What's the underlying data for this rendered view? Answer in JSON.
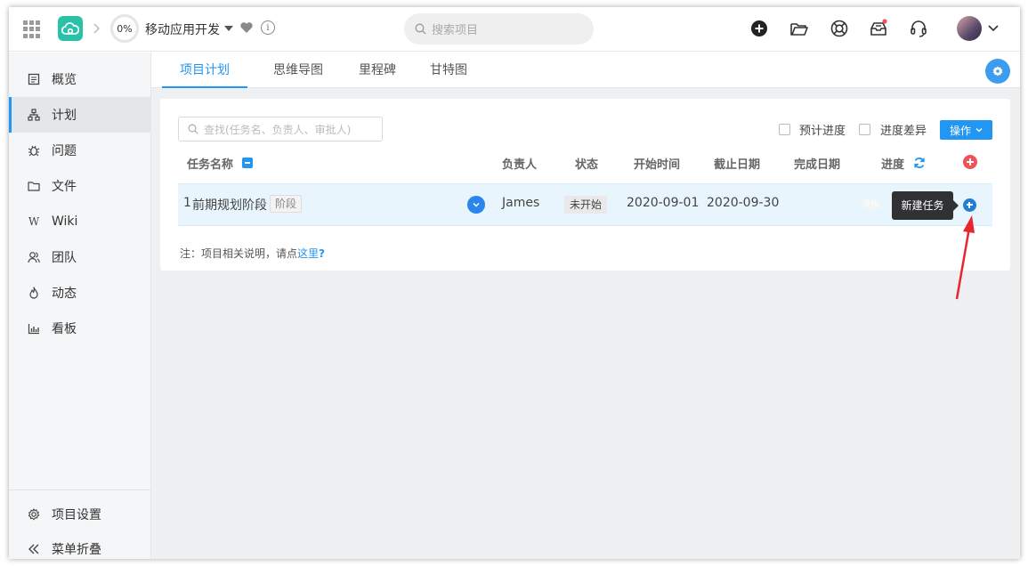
{
  "topbar": {
    "progress": "0%",
    "project_name": "移动应用开发",
    "search_placeholder": "搜索项目",
    "colors": {
      "logo": "#28c2a8",
      "notify_dot": "#f0525b"
    }
  },
  "sidebar": {
    "items": [
      {
        "label": "概览",
        "icon": "overview-icon"
      },
      {
        "label": "计划",
        "icon": "sitemap-icon",
        "active": true
      },
      {
        "label": "问题",
        "icon": "bug-icon"
      },
      {
        "label": "文件",
        "icon": "folder-icon"
      },
      {
        "label": "Wiki",
        "icon": "wiki-icon"
      },
      {
        "label": "团队",
        "icon": "team-icon"
      },
      {
        "label": "动态",
        "icon": "fire-icon"
      },
      {
        "label": "看板",
        "icon": "bar-chart-icon"
      }
    ],
    "footer": [
      {
        "label": "项目设置",
        "icon": "gear-icon"
      },
      {
        "label": "菜单折叠",
        "icon": "double-chevron-left-icon"
      }
    ]
  },
  "tabs": [
    {
      "label": "项目计划",
      "active": true
    },
    {
      "label": "思维导图"
    },
    {
      "label": "里程碑"
    },
    {
      "label": "甘特图"
    }
  ],
  "toolbar": {
    "find_placeholder": "查找(任务名、负责人、审批人)",
    "estimate_progress_label": "预计进度",
    "progress_diff_label": "进度差异",
    "operation_label": "操作"
  },
  "table": {
    "headers": {
      "task_name": "任务名称",
      "owner": "负责人",
      "status": "状态",
      "start_time": "开始时间",
      "due_date": "截止日期",
      "complete_date": "完成日期",
      "progress": "进度"
    },
    "rows": [
      {
        "index": "1",
        "name": "前期规划阶段",
        "stage_tag": "阶段",
        "owner": "James",
        "status": "未开始",
        "start": "2020-09-01",
        "due": "2020-09-30",
        "complete": "",
        "progress": "0%"
      }
    ]
  },
  "tooltip": {
    "new_task": "新建任务"
  },
  "note": {
    "prefix": "注：项目相关说明，请点",
    "link": "这里",
    "suffix": "?"
  },
  "colors": {
    "accent": "#2196f3",
    "annotation_arrow": "#e8262f"
  }
}
